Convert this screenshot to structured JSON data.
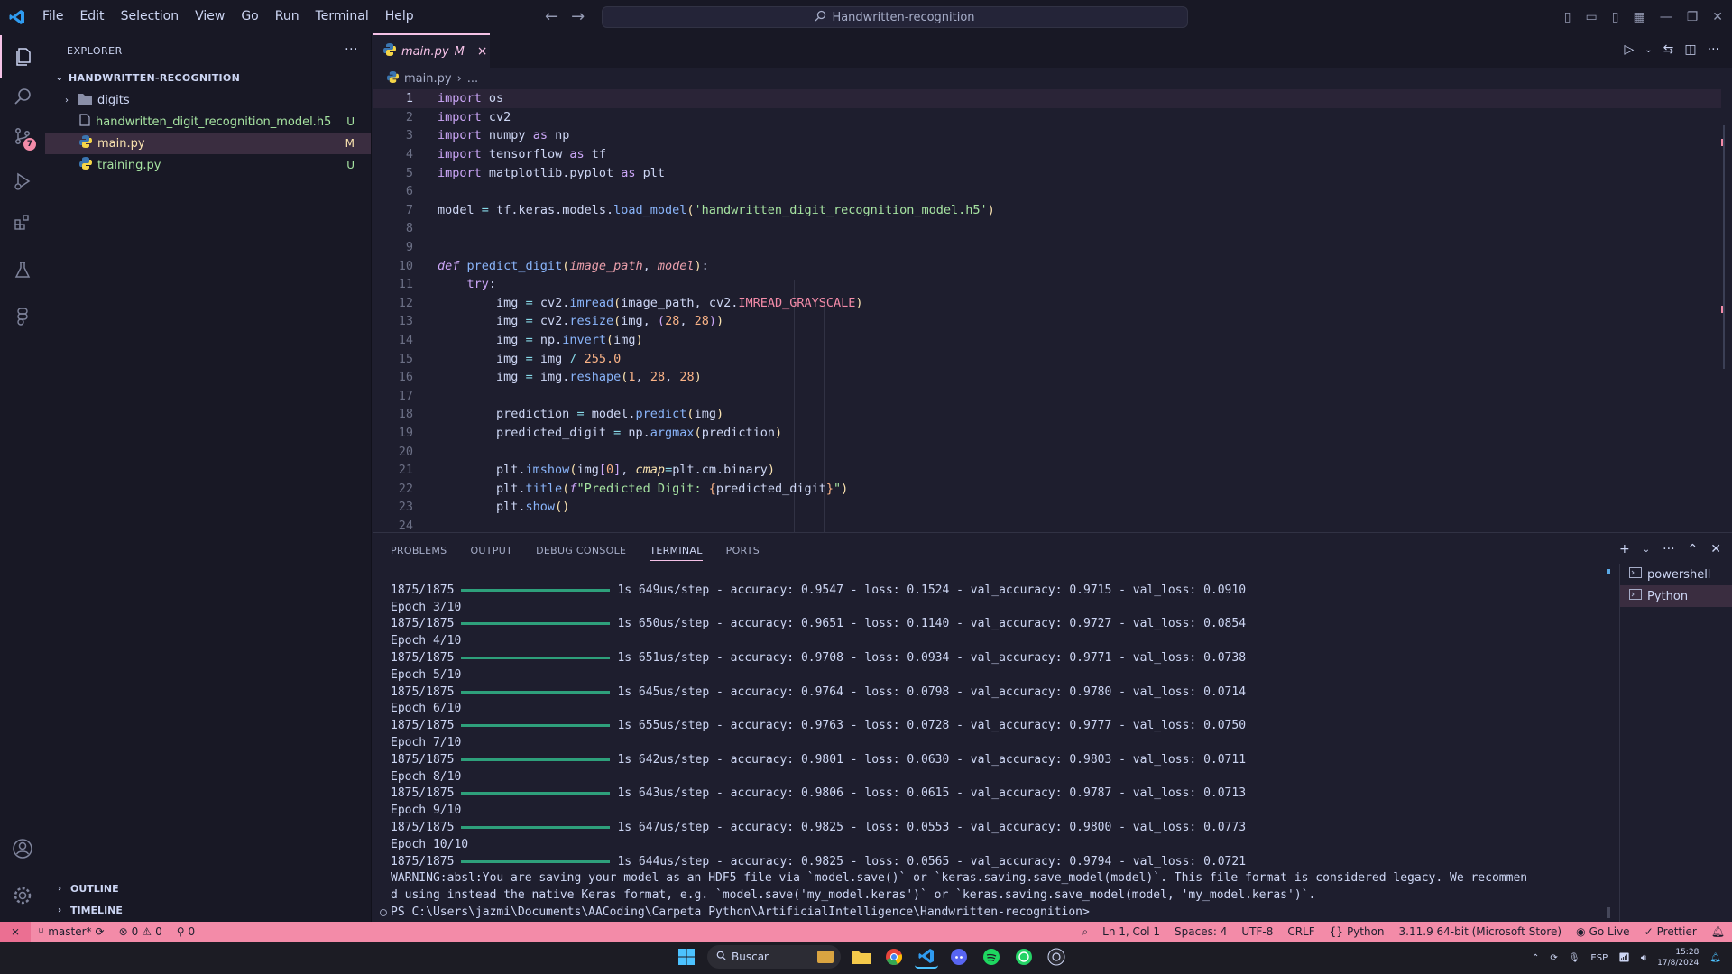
{
  "titlebar": {
    "menu": [
      "File",
      "Edit",
      "Selection",
      "View",
      "Go",
      "Run",
      "Terminal",
      "Help"
    ],
    "search_text": "Handwritten-recognition"
  },
  "sidebar": {
    "title": "EXPLORER",
    "root": "HANDWRITTEN-RECOGNITION",
    "items": [
      {
        "label": "digits",
        "type": "folder",
        "status": ""
      },
      {
        "label": "handwritten_digit_recognition_model.h5",
        "type": "file",
        "status": "U"
      },
      {
        "label": "main.py",
        "type": "python",
        "status": "M"
      },
      {
        "label": "training.py",
        "type": "python",
        "status": "U"
      }
    ],
    "outline": "OUTLINE",
    "timeline": "TIMELINE"
  },
  "activity": {
    "scm_badge": "7"
  },
  "tab": {
    "name": "main.py",
    "modifier": "M",
    "close": "×"
  },
  "breadcrumb": {
    "file": "main.py",
    "rest": "..."
  },
  "code": {
    "line_numbers": [
      "1",
      "2",
      "3",
      "4",
      "5",
      "6",
      "7",
      "8",
      "9",
      "10",
      "11",
      "12",
      "13",
      "14",
      "15",
      "16",
      "17",
      "18",
      "19",
      "20",
      "21",
      "22",
      "23",
      "24"
    ]
  },
  "panel": {
    "tabs": [
      "PROBLEMS",
      "OUTPUT",
      "DEBUG CONSOLE",
      "TERMINAL",
      "PORTS"
    ],
    "terminal_sessions": [
      "powershell",
      "Python"
    ],
    "terminal": {
      "epochs": [
        {
          "header": "",
          "step": "1875/1875",
          "rest": "1s 649us/step - accuracy: 0.9547 - loss: 0.1524 - val_accuracy: 0.9715 - val_loss: 0.0910"
        },
        {
          "header": "Epoch 3/10",
          "step": "1875/1875",
          "rest": "1s 650us/step - accuracy: 0.9651 - loss: 0.1140 - val_accuracy: 0.9727 - val_loss: 0.0854"
        },
        {
          "header": "Epoch 4/10",
          "step": "1875/1875",
          "rest": "1s 651us/step - accuracy: 0.9708 - loss: 0.0934 - val_accuracy: 0.9771 - val_loss: 0.0738"
        },
        {
          "header": "Epoch 5/10",
          "step": "1875/1875",
          "rest": "1s 645us/step - accuracy: 0.9764 - loss: 0.0798 - val_accuracy: 0.9780 - val_loss: 0.0714"
        },
        {
          "header": "Epoch 6/10",
          "step": "1875/1875",
          "rest": "1s 655us/step - accuracy: 0.9763 - loss: 0.0728 - val_accuracy: 0.9777 - val_loss: 0.0750"
        },
        {
          "header": "Epoch 7/10",
          "step": "1875/1875",
          "rest": "1s 642us/step - accuracy: 0.9801 - loss: 0.0630 - val_accuracy: 0.9803 - val_loss: 0.0711"
        },
        {
          "header": "Epoch 8/10",
          "step": "1875/1875",
          "rest": "1s 643us/step - accuracy: 0.9806 - loss: 0.0615 - val_accuracy: 0.9787 - val_loss: 0.0713"
        },
        {
          "header": "Epoch 9/10",
          "step": "1875/1875",
          "rest": "1s 647us/step - accuracy: 0.9825 - loss: 0.0553 - val_accuracy: 0.9800 - val_loss: 0.0773"
        },
        {
          "header": "Epoch 10/10",
          "step": "1875/1875",
          "rest": "1s 644us/step - accuracy: 0.9825 - loss: 0.0565 - val_accuracy: 0.9794 - val_loss: 0.0721"
        }
      ],
      "warning_1": "WARNING:absl:You are saving your model as an HDF5 file via `model.save()` or `keras.saving.save_model(model)`. This file format is considered legacy. We recommen",
      "warning_2": "d using instead the native Keras format, e.g. `model.save('my_model.keras')` or `keras.saving.save_model(model, 'my_model.keras')`.",
      "prompt": "PS C:\\Users\\jazmi\\Documents\\AACoding\\Carpeta Python\\ArtificialIntelligence\\Handwritten-recognition>"
    }
  },
  "status": {
    "branch": "master*",
    "errors": "0",
    "warnings": "0",
    "ports": "0",
    "position": "Ln 1, Col 1",
    "spaces": "Spaces: 4",
    "encoding": "UTF-8",
    "eol": "CRLF",
    "language": "Python",
    "interpreter": "3.11.9 64-bit (Microsoft Store)",
    "golive": "Go Live",
    "prettier": "Prettier"
  },
  "taskbar": {
    "search": "Buscar",
    "lang": "ESP",
    "time": "15:28",
    "date": "17/8/2024"
  },
  "colors": {
    "accent": "#f5c2e7",
    "statusbar": "#f38ba8",
    "background": "#1e1e2e"
  }
}
